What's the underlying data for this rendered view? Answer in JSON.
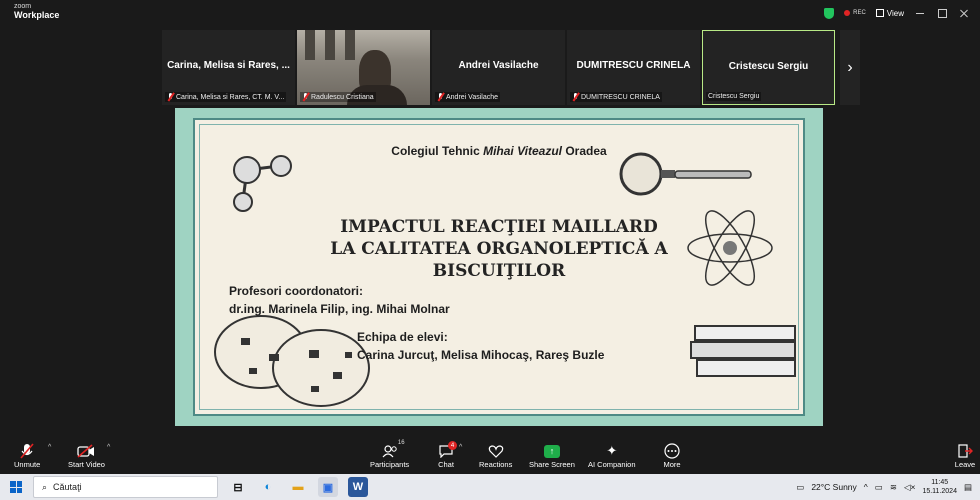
{
  "app": {
    "brand_small": "zoom",
    "brand_big": "Workplace"
  },
  "titlebar": {
    "rec": "REC",
    "view": "View"
  },
  "participants": [
    {
      "tile_name": "Carina, Melisa si Rares, ...",
      "label": "Carina, Melisa si Rares, CT. M. V...",
      "muted": true
    },
    {
      "tile_name": "",
      "label": "Radulescu Cristiana",
      "muted": true,
      "video": true
    },
    {
      "tile_name": "Andrei Vasilache",
      "label": "Andrei Vasilache",
      "muted": true
    },
    {
      "tile_name": "DUMITRESCU CRINELA",
      "label": "DUMITRESCU CRINELA",
      "muted": true
    },
    {
      "tile_name": "Cristescu Sergiu",
      "label": "Cristescu Sergiu",
      "muted": false,
      "active": true
    }
  ],
  "slide": {
    "school_prefix": "Colegiul Tehnic",
    "school_italic": "Mihai Viteazul",
    "school_suffix": "Oradea",
    "title_line1": "IMPACTUL REACŢIEI MAILLARD",
    "title_line2": "LA CALITATEA ORGANOLEPTICĂ A",
    "title_line3": "BISCUIŢILOR",
    "coord_label": "Profesori coordonatori:",
    "coord_names": "dr.ing. Marinela Filip, ing. Mihai Molnar",
    "team_label": "Echipa de elevi:",
    "team_names": "Carina Jurcuţ, Melisa Mihocaş, Rareş Buzle"
  },
  "toolbar": {
    "unmute": "Unmute",
    "start_video": "Start Video",
    "participants": "Participants",
    "participants_count": "16",
    "chat": "Chat",
    "chat_badge": "4",
    "reactions": "Reactions",
    "share_screen": "Share Screen",
    "ai_companion": "AI Companion",
    "more": "More",
    "leave": "Leave"
  },
  "taskbar": {
    "search_placeholder": "Căutaţi",
    "weather": "22°C  Sunny",
    "time": "11:45",
    "date": "15.11.2024"
  },
  "colors": {
    "slide_bg": "#9fd3c2",
    "slide_inner": "#f4efe3",
    "rec_red": "#e02424",
    "active_border": "#b8e986",
    "share_green": "#1fae4a"
  }
}
